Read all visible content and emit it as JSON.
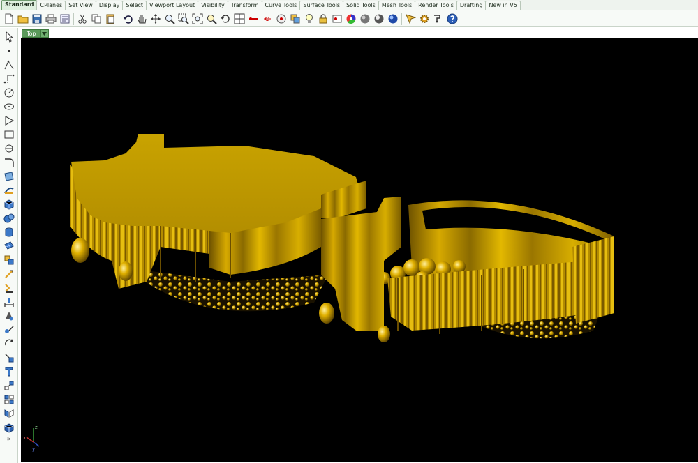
{
  "toolbar": {
    "tabs": [
      {
        "label": "Standard",
        "active": true
      },
      {
        "label": "CPlanes"
      },
      {
        "label": "Set View"
      },
      {
        "label": "Display"
      },
      {
        "label": "Select"
      },
      {
        "label": "Viewport Layout"
      },
      {
        "label": "Visibility"
      },
      {
        "label": "Transform"
      },
      {
        "label": "Curve Tools"
      },
      {
        "label": "Surface Tools"
      },
      {
        "label": "Solid Tools"
      },
      {
        "label": "Mesh Tools"
      },
      {
        "label": "Render Tools"
      },
      {
        "label": "Drafting"
      },
      {
        "label": "New in V5"
      }
    ]
  },
  "viewport": {
    "title": "Top",
    "axes": {
      "z": "z",
      "x": "x",
      "y": "y"
    }
  },
  "sidebar": {
    "more": "»"
  },
  "colors": {
    "viewport_bg": "#000000",
    "model_gold": "#c9a300",
    "tab_accent": "#5a9a5a"
  }
}
